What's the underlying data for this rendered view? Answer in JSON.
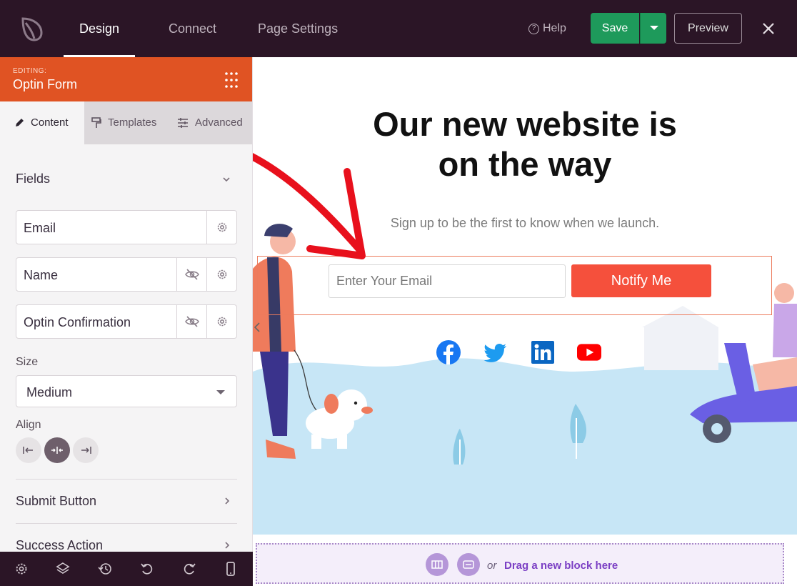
{
  "topbar": {
    "tabs": [
      {
        "label": "Design",
        "active": true
      },
      {
        "label": "Connect",
        "active": false
      },
      {
        "label": "Page Settings",
        "active": false
      }
    ],
    "help_label": "Help",
    "save_label": "Save",
    "preview_label": "Preview"
  },
  "sidebar": {
    "editing_label": "EDITING:",
    "editing_title": "Optin Form",
    "subtabs": [
      {
        "label": "Content",
        "icon": "pencil-icon",
        "active": true
      },
      {
        "label": "Templates",
        "icon": "paint-roller-icon",
        "active": false
      },
      {
        "label": "Advanced",
        "icon": "sliders-icon",
        "active": false
      }
    ],
    "fields_title": "Fields",
    "fields": [
      {
        "label": "Email",
        "hideable": false
      },
      {
        "label": "Name",
        "hideable": true
      },
      {
        "label": "Optin Confirmation",
        "hideable": true
      }
    ],
    "size_label": "Size",
    "size_value": "Medium",
    "align_label": "Align",
    "align_options": [
      "left",
      "center",
      "right"
    ],
    "align_selected": "center",
    "submit_button_title": "Submit Button",
    "success_action_title": "Success Action",
    "bottom_icons": [
      "gear-icon",
      "layers-icon",
      "history-icon",
      "undo-icon",
      "redo-icon",
      "mobile-icon"
    ]
  },
  "canvas": {
    "title_line1": "Our new website is",
    "title_line2": "on the way",
    "subtitle": "Sign up to be the first to know when we launch.",
    "email_placeholder": "Enter Your Email",
    "notify_label": "Notify Me",
    "social": [
      "facebook-icon",
      "twitter-icon",
      "linkedin-icon",
      "youtube-icon"
    ],
    "dropzone_or": "or",
    "dropzone_text": "Drag a new block here"
  },
  "colors": {
    "topbar_bg": "#2b1526",
    "editing_header": "#e05323",
    "save_green": "#1e9a5b",
    "notify_red": "#f5503c",
    "arrow_red": "#e8101c",
    "scene_blue": "#c7e6f6",
    "dropzone_purple": "#7b3fc4"
  }
}
